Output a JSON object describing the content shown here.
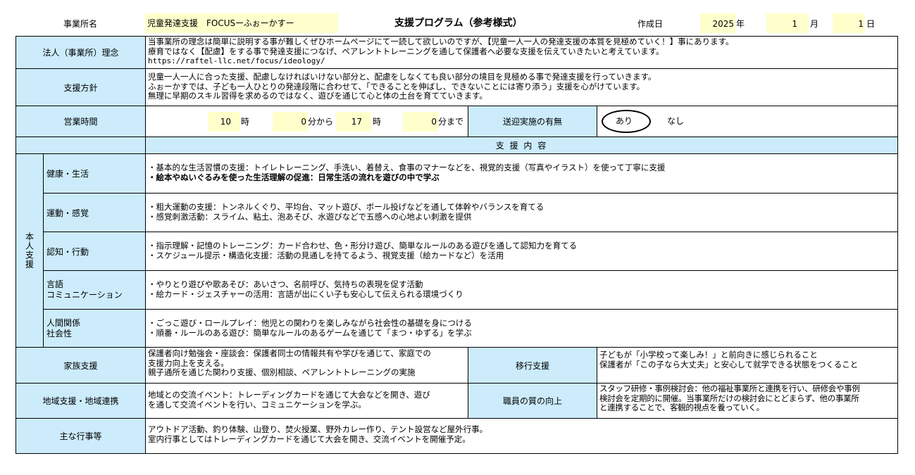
{
  "header": {
    "office_label": "事業所名",
    "office_name": "児童発達支援　FOCUSーふぉーかすー",
    "doc_title": "支援プログラム（参考様式）",
    "date_label": "作成日",
    "year": "2025",
    "year_unit": "年",
    "month": "1",
    "month_unit": "月",
    "day": "1",
    "day_unit": "日"
  },
  "philosophy": {
    "label": "法人（事業所）理念",
    "lines": [
      "当事業所の理念は簡単に説明する事が難しくぜひホームページにて一読して欲しいのですが、【児童一人一人の発達支援の本質を見極めていく！】事にあります。",
      "療育ではなく【配慮】をする事で発達支援につなげ、ペアレントトレーニングを通して保護者へ必要な支援を伝えていきたいと考えています。",
      "https://raftel-llc.net/focus/ideology/"
    ]
  },
  "policy": {
    "label": "支援方針",
    "lines": [
      "児童一人一人に合った支援、配慮しなければいけない部分と、配慮をしなくても良い部分の境目を見極める事で発達支援を行っていきます。",
      "ふぉーかすでは、子ども一人ひとりの発達段階に合わせて、「できることを伸ばし、できないことには寄り添う」支援を心がけています。",
      "無理に早期のスキル習得を求めるのではなく、遊びを通じて心と体の土台を育てていきます。"
    ]
  },
  "hours": {
    "label": "営業時間",
    "start_hour": "10",
    "hour_unit": "時",
    "start_min": "0",
    "from_unit": "分から",
    "end_hour": "17",
    "end_min": "0",
    "until_unit": "分まで",
    "transport_label": "送迎実施の有無",
    "transport_yes": "あり",
    "transport_no": "なし"
  },
  "support_header": "支 援 内 容",
  "individual": {
    "label": "本人支援",
    "rows": [
      {
        "label": "健康・生活",
        "lines": [
          {
            "text": "・基本的な生活習慣の支援：トイレトレーニング、手洗い、着替え、食事のマナーなどを、視覚的支援（写真やイラスト）を使って丁寧に支援",
            "bold": false
          },
          {
            "text": "・絵本やぬいぐるみを使った生活理解の促進：日常生活の流れを遊びの中で学ぶ",
            "bold": true
          }
        ]
      },
      {
        "label": "運動・感覚",
        "lines": [
          {
            "text": "・粗大運動の支援：トンネルくぐり、平均台、マット遊び、ボール投げなどを通して体幹やバランスを育てる",
            "bold": false
          },
          {
            "text": "・感覚刺激活動：スライム、粘土、泡あそび、水遊びなどで五感への心地よい刺激を提供",
            "bold": false
          }
        ]
      },
      {
        "label": "認知・行動",
        "lines": [
          {
            "text": "・指示理解・記憶のトレーニング：カード合わせ、色・形分け遊び、簡単なルールのある遊びを通して認知力を育てる",
            "bold": false
          },
          {
            "text": "・スケジュール提示・構造化支援：活動の見通しを持てるよう、視覚支援（絵カードなど）を活用",
            "bold": false
          }
        ]
      },
      {
        "label_lines": [
          "言語",
          "コミュニケーション"
        ],
        "lines": [
          {
            "text": "・やりとり遊びや歌あそび：あいさつ、名前呼び、気持ちの表現を促す活動",
            "bold": false
          },
          {
            "text": "・絵カード・ジェスチャーの活用：言語が出にくい子も安心して伝えられる環境づくり",
            "bold": false
          }
        ]
      },
      {
        "label_lines": [
          "人間関係",
          "社会性"
        ],
        "lines": [
          {
            "text": "・ごっこ遊び・ロールプレイ：他児との関わりを楽しみながら社会性の基礎を身につける",
            "bold": false
          },
          {
            "text": "・順番・ルールのある遊び：簡単なルールのあるゲームを通じて「まつ・ゆずる」を学ぶ",
            "bold": false
          }
        ]
      }
    ]
  },
  "family": {
    "label": "家族支援",
    "lines": [
      "保護者向け勉強会・座談会：保護者同士の情報共有や学びを通じて、家庭での",
      "支援力向上を支える。",
      "親子通所を通じた関わり支援、個別相談、ペアレントトレーニングの実施"
    ]
  },
  "transition": {
    "label": "移行支援",
    "lines": [
      "子どもが「小学校って楽しみ！」と前向きに感じられること",
      "保護者が「この子なら大丈夫」と安心して就学できる状態をつくること"
    ]
  },
  "community": {
    "label": "地域支援・地域連携",
    "lines": [
      "地域との交流イベント：トレーディングカードを通じて大会などを開き、遊び",
      "を通して交流イベントを行い、コミュニケーションを学ぶ。"
    ]
  },
  "staff": {
    "label": "職員の質の向上",
    "lines": [
      "スタッフ研修・事例検討会：他の福祉事業所と連携を行い、研修会や事例",
      "検討会を定期的に開催。当事業所だけの検討会にとどまらず、他の事業所",
      "と連携することで、客観的視点を養っていく。"
    ]
  },
  "events": {
    "label": "主な行事等",
    "lines": [
      "アウトドア活動、釣り体験、山登り、焚火授業、野外カレー作り、テント設営など屋外行事。",
      "室内行事としてはトレーディングカードを通じて大会を開き、交流イベントを開催予定。"
    ]
  }
}
